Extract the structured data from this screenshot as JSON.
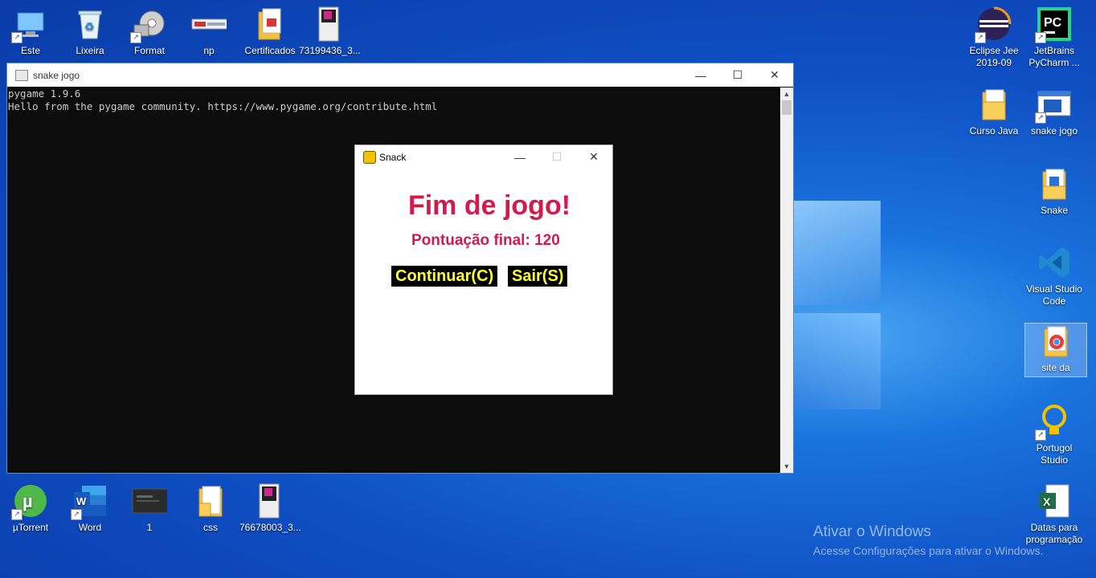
{
  "desktop": {
    "icons_top": [
      {
        "label": "Este",
        "name": "this-pc-icon"
      },
      {
        "label": "Lixeira",
        "name": "recycle-bin-icon"
      },
      {
        "label": "Format",
        "name": "format-shortcut-icon"
      },
      {
        "label": "np",
        "name": "np-file-icon"
      },
      {
        "label": "Certificados",
        "name": "certificados-folder-icon"
      },
      {
        "label": "73199436_3...",
        "name": "image-file-icon"
      }
    ],
    "icons_right": [
      {
        "label": "Eclipse Jee 2019-09",
        "name": "eclipse-icon"
      },
      {
        "label": "JetBrains PyCharm ...",
        "name": "pycharm-icon"
      },
      {
        "label": "Curso Java",
        "name": "folder-icon"
      },
      {
        "label": "snake jogo",
        "name": "snake-jogo-shortcut-icon"
      },
      {
        "label": "Snake",
        "name": "snake-folder-icon"
      },
      {
        "label": "Visual Studio Code",
        "name": "vscode-icon"
      },
      {
        "label": "site da",
        "name": "chrome-folder-icon"
      },
      {
        "label": "Portugol Studio",
        "name": "lightbulb-icon"
      },
      {
        "label": "Datas para programação",
        "name": "excel-icon"
      }
    ],
    "icons_bottom": [
      {
        "label": "µTorrent",
        "name": "utorrent-icon"
      },
      {
        "label": "Word",
        "name": "word-icon"
      },
      {
        "label": "1",
        "name": "video-file-icon"
      },
      {
        "label": "css",
        "name": "css-folder-icon"
      },
      {
        "label": "76678003_3...",
        "name": "image-file-icon"
      }
    ]
  },
  "console": {
    "title": "snake jogo",
    "lines": "pygame 1.9.6\nHello from the pygame community. https://www.pygame.org/contribute.html"
  },
  "game": {
    "title": "Snack",
    "heading": "Fim de jogo!",
    "score_text": "Pontuação final: 120",
    "continue_label": "Continuar(C)",
    "exit_label": "Sair(S)"
  },
  "watermark": {
    "line1": "Ativar o Windows",
    "line2": "Acesse Configurações para ativar o Windows."
  },
  "window_controls": {
    "minimize": "—",
    "maximize": "☐",
    "close": "✕"
  },
  "colors": {
    "game_text": "#d21a4d",
    "button_text": "#ffff33",
    "button_bg": "#000000"
  }
}
